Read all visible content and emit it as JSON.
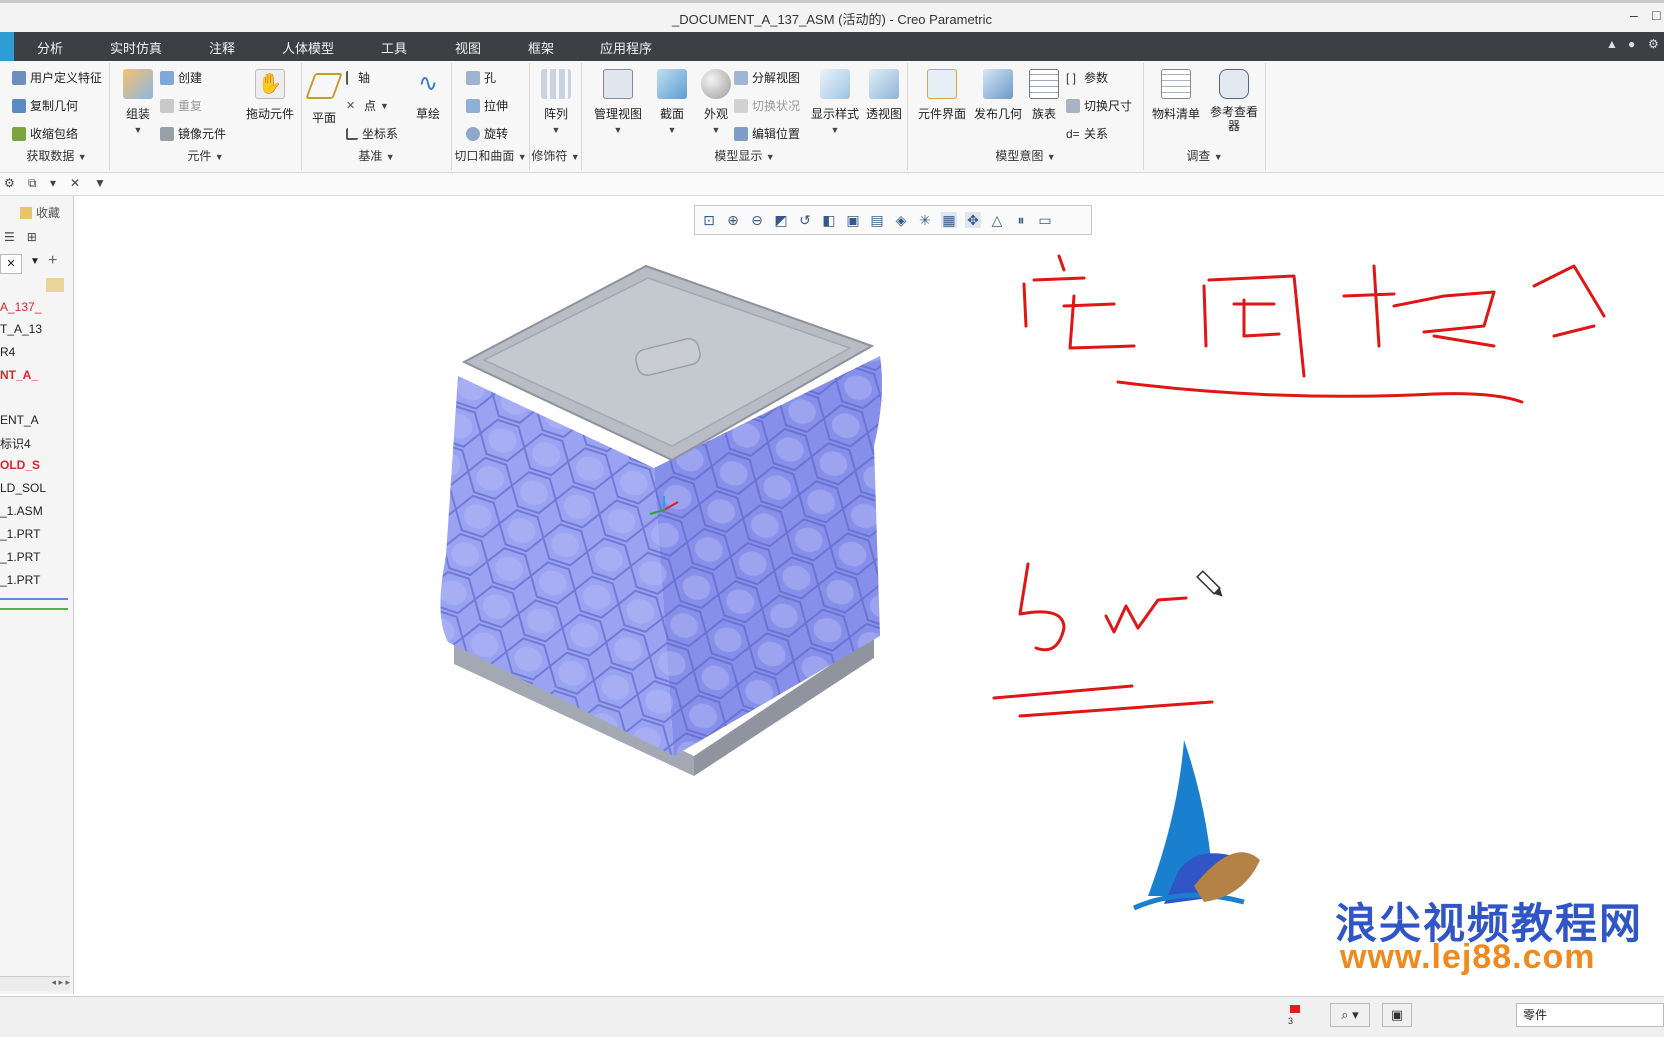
{
  "window": {
    "title": "_DOCUMENT_A_137_ASM (活动的) - Creo Parametric"
  },
  "menubar": {
    "tabs": [
      "分析",
      "实时仿真",
      "注释",
      "人体模型",
      "工具",
      "视图",
      "框架",
      "应用程序"
    ],
    "accent_color": "#2d9dd6"
  },
  "ribbon": {
    "get_data": {
      "label": "获取数据",
      "items": [
        "用户定义特征",
        "复制几何",
        "收缩包络"
      ]
    },
    "component": {
      "label": "元件",
      "assemble": "组装",
      "items": [
        "创建",
        "重复",
        "镜像元件"
      ],
      "drag": "拖动元件"
    },
    "datum": {
      "label": "基准",
      "plane": "平面",
      "items": [
        "轴",
        "点",
        "坐标系"
      ],
      "sketch": "草绘"
    },
    "cut_surface": {
      "label": "切口和曲面",
      "items": [
        "孔",
        "拉伸",
        "旋转"
      ]
    },
    "modifier": {
      "label": "修饰符",
      "pattern": "阵列"
    },
    "model_display": {
      "label": "模型显示",
      "manage_views": "管理视图",
      "section": "截面",
      "appearance": "外观",
      "items": [
        "分解视图",
        "切换状况",
        "编辑位置"
      ],
      "display_style": "显示样式",
      "perspective": "透视图"
    },
    "model_intent": {
      "label": "模型意图",
      "component_interface": "元件界面",
      "publish_geometry": "发布几何",
      "family_table": "族表",
      "items": [
        "参数",
        "切换尺寸",
        "关系"
      ]
    },
    "investigate": {
      "label": "调查",
      "bom": "物料清单",
      "reference_viewer": "参考查看器"
    }
  },
  "model_tree": {
    "tabs": [
      "收藏"
    ],
    "items": [
      {
        "text": "A_137_",
        "style": "redn"
      },
      {
        "text": "T_A_13",
        "style": "normal"
      },
      {
        "text": "R4",
        "style": "normal"
      },
      {
        "text": "NT_A_",
        "style": "red"
      },
      {
        "text": "ENT_A",
        "style": "normal"
      },
      {
        "text": "标识4",
        "style": "normal"
      },
      {
        "text": "OLD_S",
        "style": "red"
      },
      {
        "text": "LD_SOL",
        "style": "normal"
      },
      {
        "text": "_1.ASM",
        "style": "normal"
      },
      {
        "text": "_1.PRT",
        "style": "normal"
      },
      {
        "text": "_1.PRT",
        "style": "normal"
      },
      {
        "text": "_1.PRT",
        "style": "normal"
      }
    ]
  },
  "viewport": {
    "model_color": "#9aa3f2",
    "lid_color": "#b8bcc4",
    "annotation_color": "#e01515"
  },
  "watermark": {
    "cn": "浪尖视频教程网",
    "url": "www.lej88.com"
  },
  "statusbar": {
    "filter": "零件",
    "flag_count": "3"
  }
}
